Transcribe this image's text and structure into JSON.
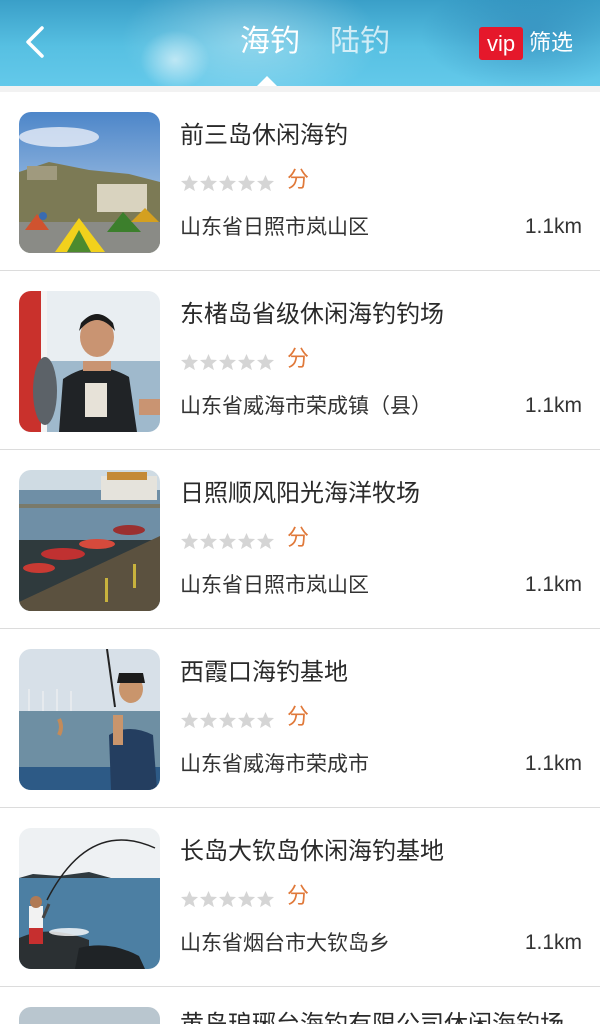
{
  "header": {
    "tabs": [
      {
        "label": "海钓",
        "active": true
      },
      {
        "label": "陆钓",
        "active": false
      }
    ],
    "vip_label": "vip",
    "filter_label": "筛选"
  },
  "colors": {
    "accent": "#e0793a",
    "vip": "#e5182b",
    "header": "#57c0e2"
  },
  "spots": [
    {
      "name": "前三岛休闲海钓",
      "score_label": "分",
      "rating": 0,
      "address": "山东省日照市岚山区",
      "distance": "1.1km",
      "image": "campsite-with-tents"
    },
    {
      "name": "东楮岛省级休闲海钓钓场",
      "score_label": "分",
      "rating": 0,
      "address": "山东省威海市荣成镇（县）",
      "distance": "1.1km",
      "image": "man-holding-fish"
    },
    {
      "name": "日照顺风阳光海洋牧场",
      "score_label": "分",
      "rating": 0,
      "address": "山东省日照市岚山区",
      "distance": "1.1km",
      "image": "marina-with-boats"
    },
    {
      "name": "西霞口海钓基地",
      "score_label": "分",
      "rating": 0,
      "address": "山东省威海市荣成市",
      "distance": "1.1km",
      "image": "angler-on-boat"
    },
    {
      "name": "长岛大钦岛休闲海钓基地",
      "score_label": "分",
      "rating": 0,
      "address": "山东省烟台市大钦岛乡",
      "distance": "1.1km",
      "image": "angler-on-rocks"
    }
  ],
  "partial_item": {
    "name": "黄岛琅琊台海钓有限公司休闲海钓场"
  }
}
